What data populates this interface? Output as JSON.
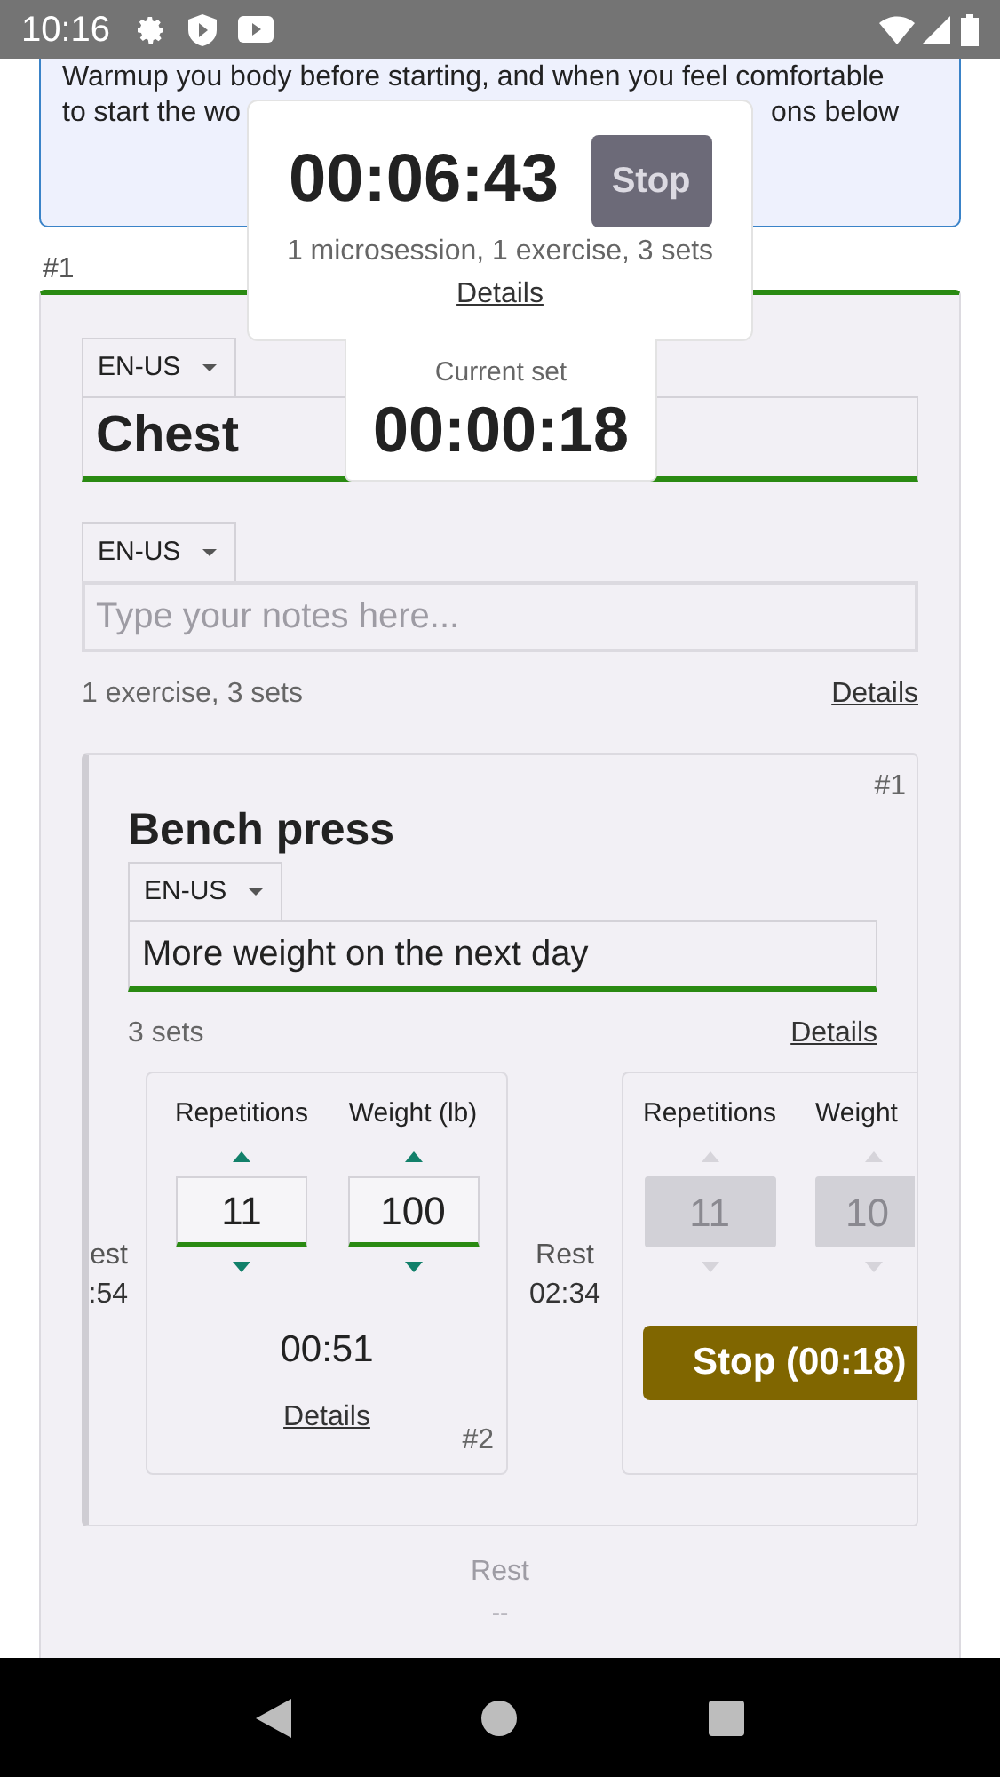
{
  "status_bar": {
    "time": "10:16"
  },
  "intro": {
    "line_1": "Warmup you body before starting, and when you feel comfortable",
    "line_2_start": "to start the wo",
    "line_2_end": "ons below"
  },
  "timer": {
    "elapsed": "00:06:43",
    "stop_button": "Stop",
    "summary": "1 microsession, 1 exercise, 3 sets",
    "details_link": "Details",
    "current_set_label": "Current set",
    "current_set_time": "00:00:18"
  },
  "session": {
    "number": "#1",
    "language": "EN-US",
    "title": "Chest",
    "notes_language": "EN-US",
    "notes_placeholder": "Type your notes here...",
    "summary": "1 exercise, 3 sets",
    "details_link": "Details",
    "exercise": {
      "number": "#1",
      "title": "Bench press",
      "language": "EN-US",
      "note": "More weight on the next day",
      "summary": "3 sets",
      "details_link": "Details",
      "row": [
        {
          "kind": "rest",
          "label": "est",
          "time": ":54"
        },
        {
          "kind": "set",
          "disabled": false,
          "columns": [
            {
              "label": "Repetitions",
              "value": "11"
            },
            {
              "label": "Weight (lb)",
              "value": "100"
            }
          ],
          "duration": "00:51",
          "details_link": "Details",
          "number": "#2"
        },
        {
          "kind": "rest",
          "label": "Rest",
          "time": "02:34"
        },
        {
          "kind": "set",
          "disabled": true,
          "columns": [
            {
              "label": "Repetitions",
              "value": "11"
            },
            {
              "label": "Weight",
              "value": "10"
            }
          ],
          "stop_button": "Stop (00:18)"
        }
      ]
    }
  },
  "next_rest": {
    "label": "Rest",
    "time": "--"
  }
}
